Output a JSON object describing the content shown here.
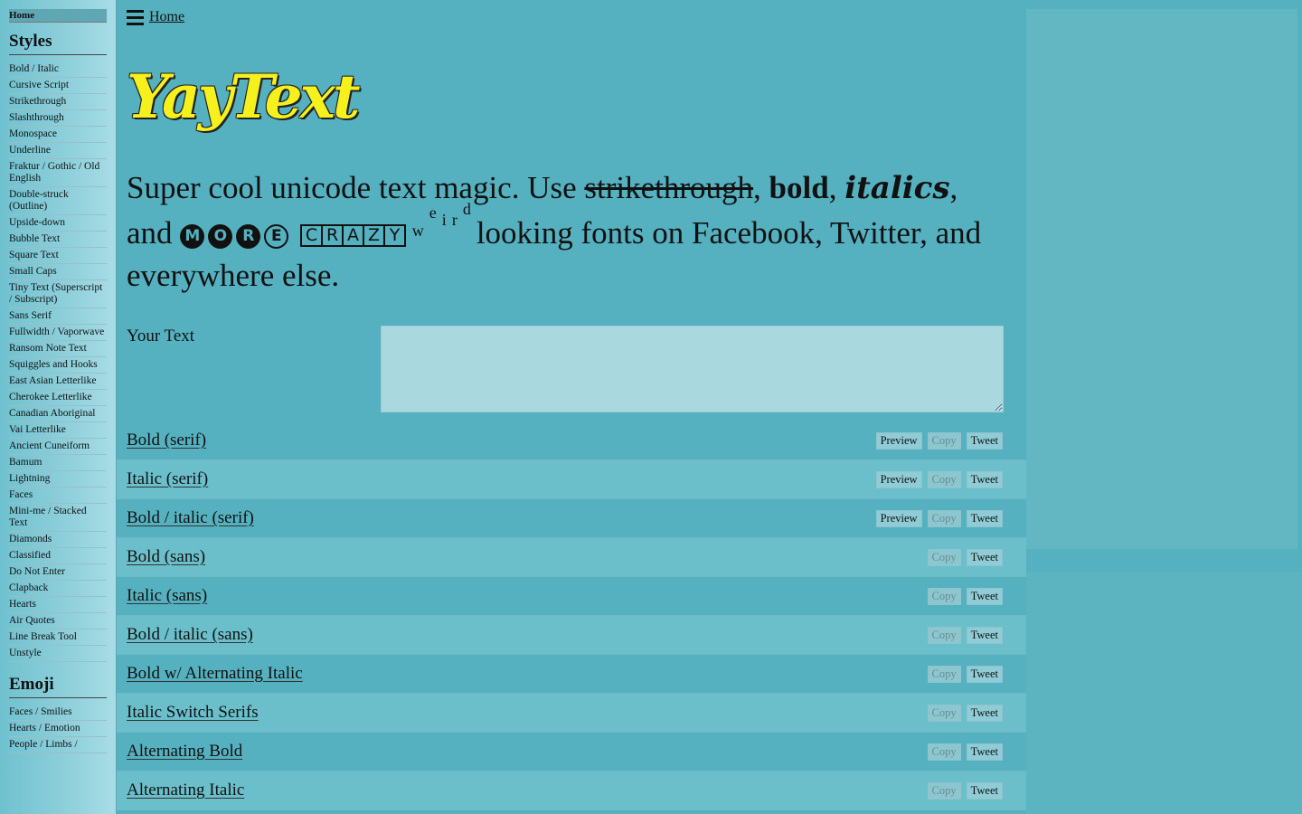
{
  "sidebar": {
    "home": "Home",
    "styles_title": "Styles",
    "styles": [
      "Bold / Italic",
      "Cursive Script",
      "Strikethrough",
      "Slashthrough",
      "Monospace",
      "Underline",
      "Fraktur / Gothic / Old English",
      "Double-struck (Outline)",
      "Upside-down",
      "Bubble Text",
      "Square Text",
      "Small Caps",
      "Tiny Text (Superscript / Subscript)",
      "Sans Serif",
      "Fullwidth / Vaporwave",
      "Ransom Note Text",
      "Squiggles and Hooks",
      "East Asian Letterlike",
      "Cherokee Letterlike",
      "Canadian Aboriginal",
      "Vai Letterlike",
      "Ancient Cuneiform",
      "Bamum",
      "Lightning",
      "Faces",
      "Mini-me / Stacked Text",
      "Diamonds",
      "Classified",
      "Do Not Enter",
      "Clapback",
      "Hearts",
      "Air Quotes",
      "Line Break Tool",
      "Unstyle"
    ],
    "emoji_title": "Emoji",
    "emoji": [
      "Faces / Smilies",
      "Hearts / Emotion",
      "People / Limbs /"
    ]
  },
  "header": {
    "home": "Home"
  },
  "logo": "YayText",
  "tagline": {
    "p1": "Super cool unicode text magic. Use ",
    "strike": "strikethrough",
    "p2": ", ",
    "bold": "bold",
    "p3": ", ",
    "italics": "italics",
    "p4": ", and ",
    "more": [
      "M",
      "O",
      "R",
      "E"
    ],
    "crazy": [
      "C",
      "R",
      "A",
      "Z",
      "Y"
    ],
    "weird": [
      "w",
      "e",
      "i",
      "r",
      "d"
    ],
    "p5": "looking fonts on Facebook, Twitter, and everywhere else."
  },
  "input": {
    "label": "Your Text",
    "value": ""
  },
  "buttons": {
    "preview": "Preview",
    "copy": "Copy",
    "tweet": "Tweet"
  },
  "rows": [
    {
      "title": "Bold (serif)",
      "preview": true
    },
    {
      "title": "Italic (serif)",
      "preview": true
    },
    {
      "title": "Bold / italic (serif)",
      "preview": true
    },
    {
      "title": "Bold (sans)",
      "preview": false
    },
    {
      "title": "Italic (sans)",
      "preview": false
    },
    {
      "title": "Bold / italic (sans)",
      "preview": false
    },
    {
      "title": "Bold w/ Alternating Italic",
      "preview": false
    },
    {
      "title": "Italic Switch Serifs",
      "preview": false
    },
    {
      "title": "Alternating Bold",
      "preview": false
    },
    {
      "title": "Alternating Italic",
      "preview": false
    }
  ]
}
